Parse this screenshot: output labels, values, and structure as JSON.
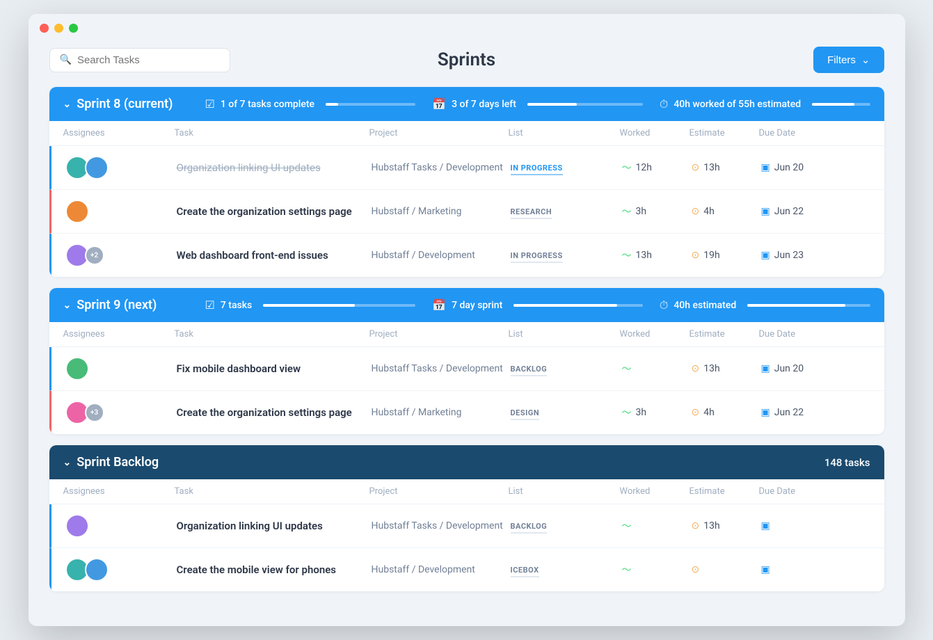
{
  "window": {
    "title": "Sprints"
  },
  "header": {
    "search_placeholder": "Search Tasks",
    "page_title": "Sprints",
    "filters_label": "Filters"
  },
  "sprints": [
    {
      "id": "sprint8",
      "name": "Sprint 8 (current)",
      "tasks_complete": "1 of 7 tasks complete",
      "tasks_complete_pct": 14,
      "days_left": "3 of 7 days left",
      "days_left_pct": 43,
      "hours_info": "40h worked of 55h estimated",
      "hours_pct": 73,
      "color": "blue",
      "columns": [
        "Assignees",
        "Task",
        "Project",
        "List",
        "Worked",
        "Estimate",
        "Due Date"
      ],
      "rows": [
        {
          "border": "blue",
          "assignees": [
            "teal",
            "blue"
          ],
          "task": "Organization linking UI updates",
          "strikethrough": true,
          "project": "Hubstaff Tasks / Development",
          "list": "IN PROGRESS",
          "list_style": "blue",
          "worked": "12h",
          "estimate": "13h",
          "due": "Jun 20"
        },
        {
          "border": "red",
          "assignees": [
            "orange"
          ],
          "task": "Create the organization settings page",
          "strikethrough": false,
          "project": "Hubstaff / Marketing",
          "list": "RESEARCH",
          "list_style": "gray",
          "worked": "3h",
          "estimate": "4h",
          "due": "Jun 22"
        },
        {
          "border": "blue",
          "assignees": [
            "purple",
            "+2"
          ],
          "task": "Web dashboard front-end issues",
          "strikethrough": false,
          "project": "Hubstaff / Development",
          "list": "IN PROGRESS",
          "list_style": "gray",
          "worked": "13h",
          "estimate": "19h",
          "due": "Jun 23"
        }
      ]
    },
    {
      "id": "sprint9",
      "name": "Sprint 9 (next)",
      "tasks_complete": "7 tasks",
      "tasks_complete_pct": 60,
      "days_left": "7 day sprint",
      "days_left_pct": 80,
      "hours_info": "40h estimated",
      "hours_pct": 80,
      "color": "blue",
      "columns": [
        "Assignees",
        "Task",
        "Project",
        "List",
        "Worked",
        "Estimate",
        "Due Date"
      ],
      "rows": [
        {
          "border": "blue",
          "assignees": [
            "green"
          ],
          "task": "Fix mobile dashboard view",
          "strikethrough": false,
          "project": "Hubstaff Tasks / Development",
          "list": "BACKLOG",
          "list_style": "gray",
          "worked": "",
          "estimate": "13h",
          "due": "Jun 20"
        },
        {
          "border": "red",
          "assignees": [
            "pink",
            "+3"
          ],
          "task": "Create the organization settings page",
          "strikethrough": false,
          "project": "Hubstaff / Marketing",
          "list": "DESIGN",
          "list_style": "gray",
          "worked": "3h",
          "estimate": "4h",
          "due": "Jun 22"
        }
      ]
    },
    {
      "id": "backlog",
      "name": "Sprint Backlog",
      "tasks_count": "148 tasks",
      "color": "dark",
      "columns": [
        "Assignees",
        "Task",
        "Project",
        "List",
        "Worked",
        "Estimate",
        "Due Date"
      ],
      "rows": [
        {
          "border": "blue",
          "assignees": [
            "purple"
          ],
          "task": "Organization linking UI updates",
          "strikethrough": false,
          "project": "Hubstaff Tasks / Development",
          "list": "BACKLOG",
          "list_style": "gray",
          "worked": "",
          "estimate": "13h",
          "due": ""
        },
        {
          "border": "blue",
          "assignees": [
            "teal",
            "blue"
          ],
          "task": "Create the mobile view for phones",
          "strikethrough": false,
          "project": "Hubstaff / Development",
          "list": "ICEBOX",
          "list_style": "gray",
          "worked": "",
          "estimate": "",
          "due": ""
        }
      ]
    }
  ]
}
